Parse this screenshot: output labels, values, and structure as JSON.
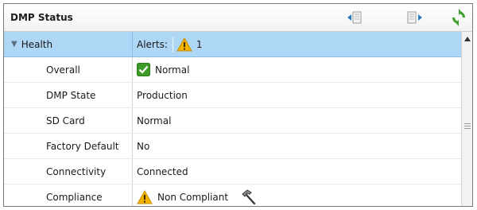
{
  "panel": {
    "title": "DMP Status"
  },
  "toolbar": {
    "prev_icon": "collapse-left-icon",
    "next_icon": "expand-right-icon",
    "refresh_icon": "refresh-icon"
  },
  "group": {
    "label": "Health",
    "alerts_label": "Alerts:",
    "alerts_count": "1"
  },
  "rows": [
    {
      "label": "Overall",
      "value": "Normal",
      "icon": "check-icon"
    },
    {
      "label": "DMP State",
      "value": "Production"
    },
    {
      "label": "SD Card",
      "value": "Normal"
    },
    {
      "label": "Factory Default",
      "value": "No"
    },
    {
      "label": "Connectivity",
      "value": "Connected"
    },
    {
      "label": "Compliance",
      "value": "Non Compliant",
      "icon": "warning-icon",
      "action_icon": "hammer-icon"
    }
  ],
  "colors": {
    "header_row": "#aed6f5",
    "check": "#3c9a26",
    "warning": "#f2b200"
  }
}
